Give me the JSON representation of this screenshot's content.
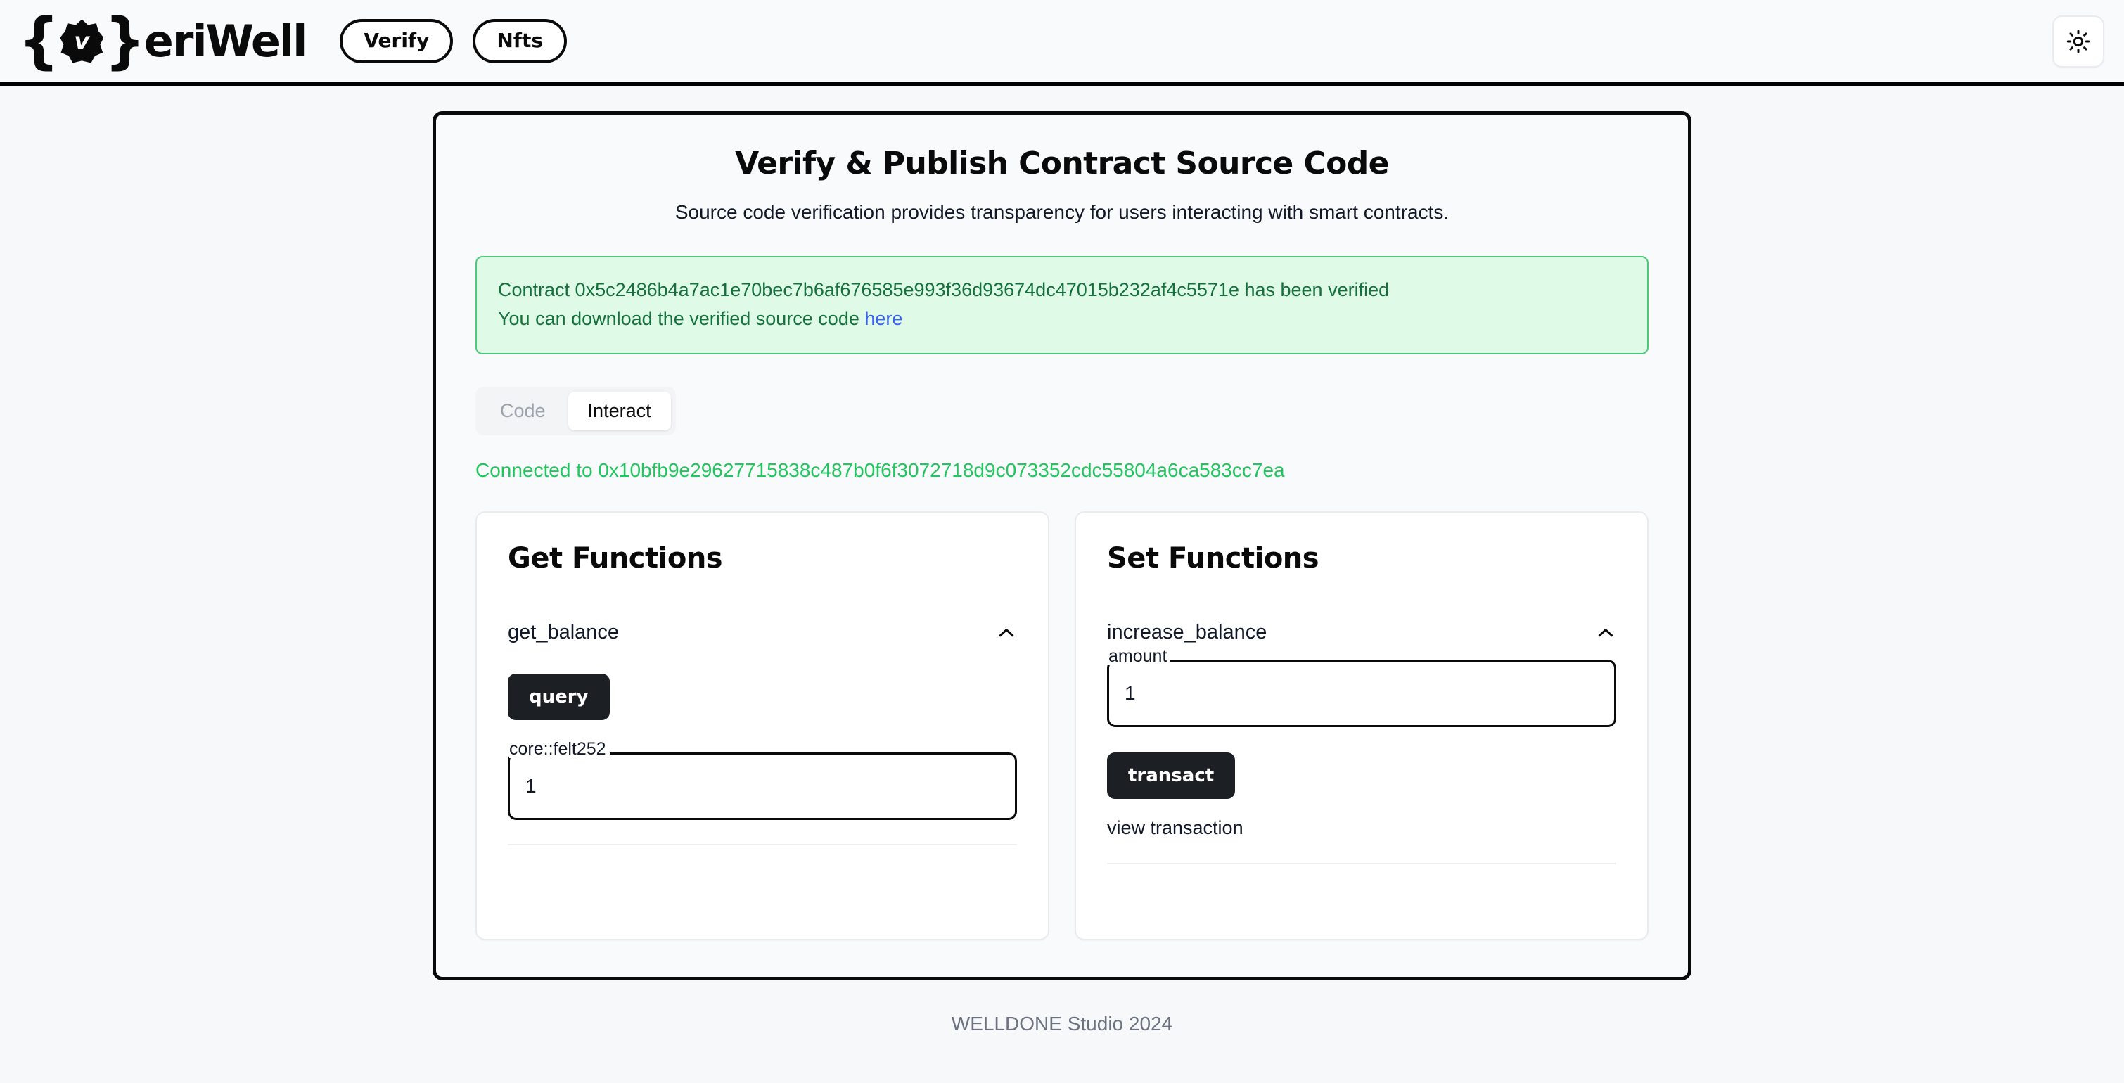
{
  "header": {
    "logo": {
      "left_brace": "{",
      "vee": "v",
      "right_brace": "}",
      "text": "eriWell"
    },
    "nav": [
      {
        "label": "Verify",
        "name": "nav-verify"
      },
      {
        "label": "Nfts",
        "name": "nav-nfts"
      }
    ],
    "theme_toggle_icon": "sun-icon"
  },
  "main": {
    "title": "Verify & Publish Contract Source Code",
    "subtitle": "Source code verification provides transparency for users interacting with smart contracts.",
    "alert": {
      "line1_prefix": "Contract ",
      "contract_address": "0x5c2486b4a7ac1e70bec7b6af676585e993f36d93674dc47015b232af4c5571e",
      "line1_suffix": " has been verified",
      "line2_prefix": "You can download the verified source code ",
      "link_label": "here",
      "bg_color": "#dffbe8",
      "border_color": "#4ec97c",
      "text_color": "#14713b",
      "link_color": "#3b63e8"
    },
    "tabs": [
      {
        "label": "Code",
        "active": false
      },
      {
        "label": "Interact",
        "active": true
      }
    ],
    "connected": {
      "prefix": "Connected to ",
      "address": "0x10bfb9e29627715838c487b0f6f3072718d9c073352cdc55804a6ca583cc7ea",
      "color": "#22c55e"
    },
    "get_card": {
      "title": "Get Functions",
      "function_name": "get_balance",
      "collapse_icon": "chevron-up-icon",
      "query_button": "query",
      "result_label": "core::felt252",
      "result_value": "1"
    },
    "set_card": {
      "title": "Set Functions",
      "function_name": "increase_balance",
      "collapse_icon": "chevron-up-icon",
      "amount_label": "amount",
      "amount_value": "1",
      "transact_button": "transact",
      "view_transaction": "view transaction"
    }
  },
  "footer": {
    "text": "WELLDONE Studio 2024"
  }
}
